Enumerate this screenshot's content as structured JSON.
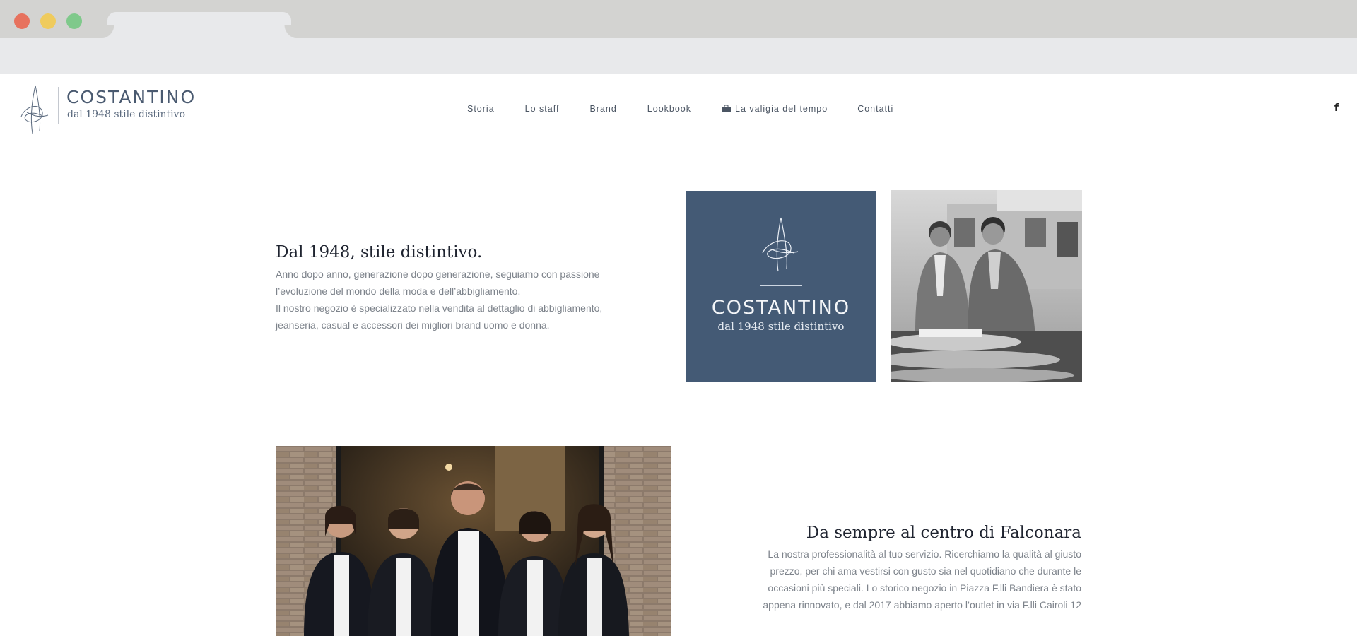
{
  "brand": {
    "name": "COSTANTINO",
    "tagline": "dal 1948 stile distintivo"
  },
  "nav": {
    "items": [
      {
        "label": "Storia"
      },
      {
        "label": "Lo staff"
      },
      {
        "label": "Brand"
      },
      {
        "label": "Lookbook"
      },
      {
        "label": "La valigia del tempo",
        "icon": "suitcase-icon"
      },
      {
        "label": "Contatti"
      }
    ],
    "social": {
      "label": "f",
      "icon": "facebook-icon"
    }
  },
  "intro": {
    "heading": "Dal 1948, stile distintivo.",
    "lines": [
      "Anno dopo anno, generazione dopo generazione, seguiamo con passione",
      "l’evoluzione del mondo della moda e dell’abbigliamento.",
      "Il nostro negozio è specializzato nella vendita al dettaglio di abbigliamento,",
      "jeanseria, casual e accessori dei migliori brand uomo e donna."
    ]
  },
  "brand_card": {
    "name": "COSTANTINO",
    "tagline": "dal 1948 stile distintivo",
    "color": "#445a75"
  },
  "center": {
    "heading": "Da sempre al centro di Falconara",
    "lines": [
      "La nostra professionalità al tuo servizio. Ricerchiamo la qualità al giusto",
      "prezzo, per chi ama vestirsi con gusto sia nel quotidiano che durante le",
      "occasioni più speciali. Lo storico negozio in Piazza F.lli Bandiera è stato",
      "appena rinnovato, e dal 2017 abbiamo aperto l’outlet in via F.lli Cairoli 12"
    ]
  }
}
